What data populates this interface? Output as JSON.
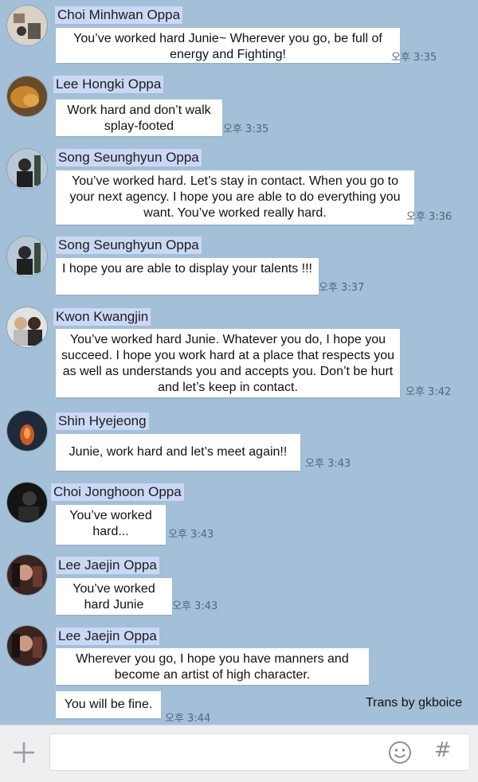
{
  "messages": [
    {
      "sender": "Choi Minhwan Oppa",
      "text": "You’ve worked hard Junie~ Wherever you go, be full of energy and Fighting!",
      "time": "오후 3:35"
    },
    {
      "sender": "Lee Hongki Oppa",
      "text": "Work hard and don’t walk splay-footed",
      "time": "오후 3:35"
    },
    {
      "sender": "Song Seunghyun Oppa",
      "text": "You’ve worked hard. Let’s stay in contact. When you go to your next agency. I hope you are able to do everything you want. You’ve worked really hard.",
      "time": "오후 3:36"
    },
    {
      "sender": "Song Seunghyun Oppa",
      "text": "I hope you are able to display your talents !!!",
      "time": "오후 3:37"
    },
    {
      "sender": "Kwon Kwangjin",
      "text": "You’ve worked hard Junie. Whatever you do, I hope you succeed. I hope you work hard at a place that respects you as well as understands you and accepts you. Don’t be hurt and let’s keep in contact.",
      "time": "오후 3:42"
    },
    {
      "sender": "Shin Hyejeong",
      "text": "Junie, work hard and let’s meet again!!",
      "time": "오후 3:43"
    },
    {
      "sender": "Choi Jonghoon Oppa",
      "text": "You’ve worked hard...",
      "time": "오후 3:43"
    },
    {
      "sender": "Lee Jaejin Oppa",
      "text": "You’ve worked hard Junie",
      "time": "오후 3:43"
    },
    {
      "sender": "Lee Jaejin Oppa",
      "text": "Wherever you go, I hope you have manners and become an artist of high character."
    },
    {
      "text": "You will be fine.",
      "time": "오후 3:44"
    }
  ],
  "credit": "Trans by gkboice",
  "input_bar": {
    "attach_icon": "plus-icon",
    "emoji_icon": "smiley-icon",
    "hash_label": "#"
  },
  "colors": {
    "background": "#a4bfd8",
    "name_highlight": "#cbd8f5",
    "bubble": "#ffffff"
  }
}
